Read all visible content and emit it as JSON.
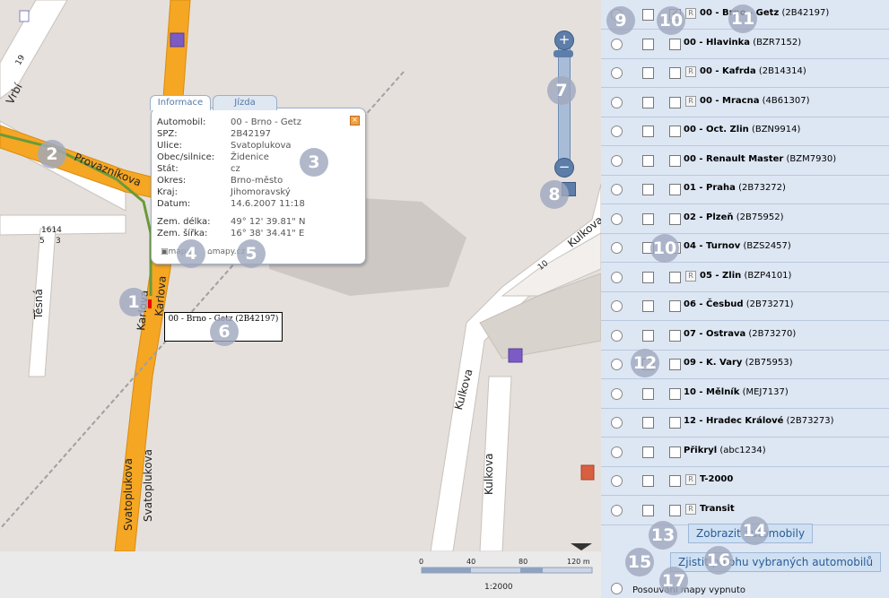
{
  "map": {
    "street_labels": [
      "Vrbí",
      "Provazníkova",
      "Těsná",
      "Karlova",
      "Karlova",
      "Svatoplukova",
      "Svatoplukova",
      "Kulkova",
      "Kulkova",
      "Kulkova"
    ],
    "house_numbers": [
      "19",
      "1614",
      "5",
      "3",
      "10"
    ],
    "popup": {
      "tab_info": "Informace",
      "tab_ride": "Jízda",
      "rows": [
        {
          "k": "Automobil:",
          "v": "00 - Brno - Getz"
        },
        {
          "k": "SPZ:",
          "v": "2B42197"
        },
        {
          "k": "Ulice:",
          "v": "Svatoplukova"
        },
        {
          "k": "Obec/silnice:",
          "v": "Židenice"
        },
        {
          "k": "Stát:",
          "v": "cz"
        },
        {
          "k": "Okres:",
          "v": "Brno-město"
        },
        {
          "k": "Kraj:",
          "v": "Jihomoravský"
        },
        {
          "k": "Datum:",
          "v": "14.6.2007 11:18"
        },
        {
          "k": "Zem. délka:",
          "v": "49° 12' 39.81\" N"
        },
        {
          "k": "Zem. šířka:",
          "v": "16° 38' 34.41\" E"
        }
      ],
      "link1": "mapa",
      "link2": "mapy.cz"
    },
    "tooltip": "00 - Brno - Getz (2B42197)",
    "scale": {
      "ticks": [
        "0",
        "40",
        "80",
        "120 m"
      ],
      "ratio": "1:2000"
    }
  },
  "sidebar": {
    "vehicles": [
      {
        "name": "00 - Brno - Getz",
        "plate": "(2B42197)",
        "r": true,
        "checked": true
      },
      {
        "name": "00 - Hlavinka",
        "plate": "(BZR7152)",
        "r": false
      },
      {
        "name": "00 - Kafrda",
        "plate": "(2B14314)",
        "r": true
      },
      {
        "name": "00 - Mracna",
        "plate": "(4B61307)",
        "r": true
      },
      {
        "name": "00 - Oct. Zlin",
        "plate": "(BZN9914)",
        "r": false
      },
      {
        "name": "00 - Renault Master",
        "plate": "(BZM7930)",
        "r": false
      },
      {
        "name": "01 - Praha",
        "plate": "(2B73272)",
        "r": false
      },
      {
        "name": "02 - Plzeň",
        "plate": "(2B75952)",
        "r": false
      },
      {
        "name": "04 - Turnov",
        "plate": "(BZS2457)",
        "r": false
      },
      {
        "name": "05 - Zlin",
        "plate": "(BZP4101)",
        "r": true
      },
      {
        "name": "06 - Česbud",
        "plate": "(2B73271)",
        "r": false
      },
      {
        "name": "07 - Ostrava",
        "plate": "(2B73270)",
        "r": false
      },
      {
        "name": "09 - K. Vary",
        "plate": "(2B75953)",
        "r": false
      },
      {
        "name": "10 - Mělník",
        "plate": "(MEJ7137)",
        "r": false
      },
      {
        "name": "12 - Hradec Králové",
        "plate": "(2B73273)",
        "r": false
      },
      {
        "name": "Přikryl",
        "plate": "(abc1234)",
        "r": false
      },
      {
        "name": "T-2000",
        "plate": "",
        "r": true
      },
      {
        "name": "Transit",
        "plate": "",
        "r": true
      }
    ],
    "show_button": "Zobrazit automobily",
    "locate_button": "Zjistit polohu vybraných automobilů",
    "map_scroll_label": "Posouvání mapy vypnuto"
  },
  "badges": [
    "1",
    "2",
    "3",
    "4",
    "5",
    "6",
    "7",
    "8",
    "9",
    "10",
    "10",
    "11",
    "12",
    "13",
    "14",
    "15",
    "16",
    "17"
  ],
  "colors": {
    "road_major": "#f5a623",
    "route": "#6a9a3a",
    "sidebar_bg": "#dde6f3",
    "badge": "#a0a8be"
  }
}
